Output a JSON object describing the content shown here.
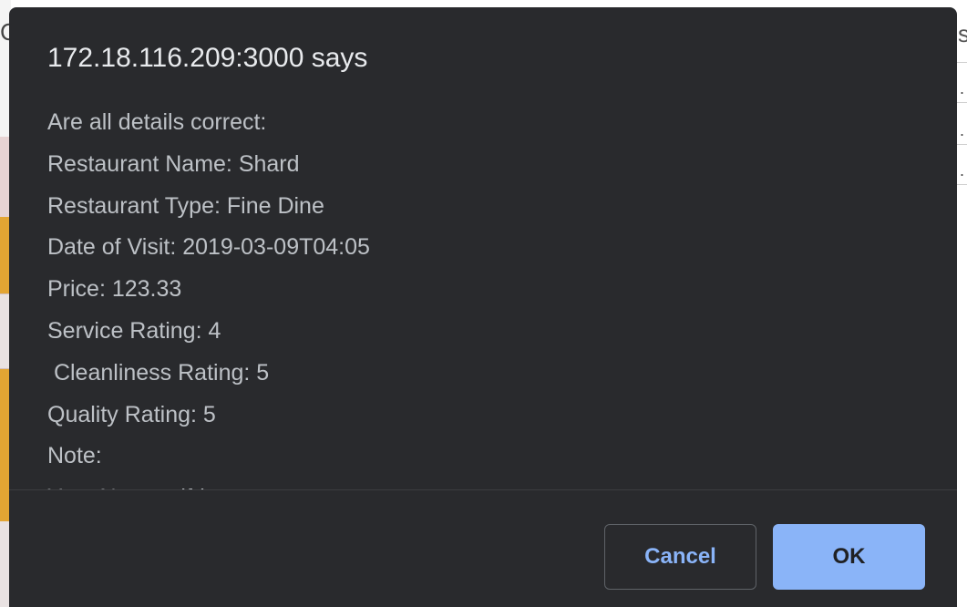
{
  "background": {
    "left_glyph": "C",
    "right_glyph": "s",
    "right_dots": [
      ".",
      ".",
      "."
    ]
  },
  "dialog": {
    "title": "172.18.116.209:3000 says",
    "message_lines": [
      "Are all details correct:",
      "Restaurant Name: Shard",
      "Restaurant Type: Fine Dine",
      "Date of Visit: 2019-03-09T04:05",
      "Price: 123.33",
      "Service Rating: 4",
      " Cleanliness Rating: 5",
      "Quality Rating: 5",
      "Note: ",
      "Your Name: dfd"
    ],
    "buttons": {
      "cancel_label": "Cancel",
      "ok_label": "OK"
    },
    "colors": {
      "dialog_background": "#292a2d",
      "title_text": "#e8eaed",
      "message_text": "#bdc1c6",
      "accent": "#8ab4f8",
      "button_border": "#5f6368"
    }
  }
}
